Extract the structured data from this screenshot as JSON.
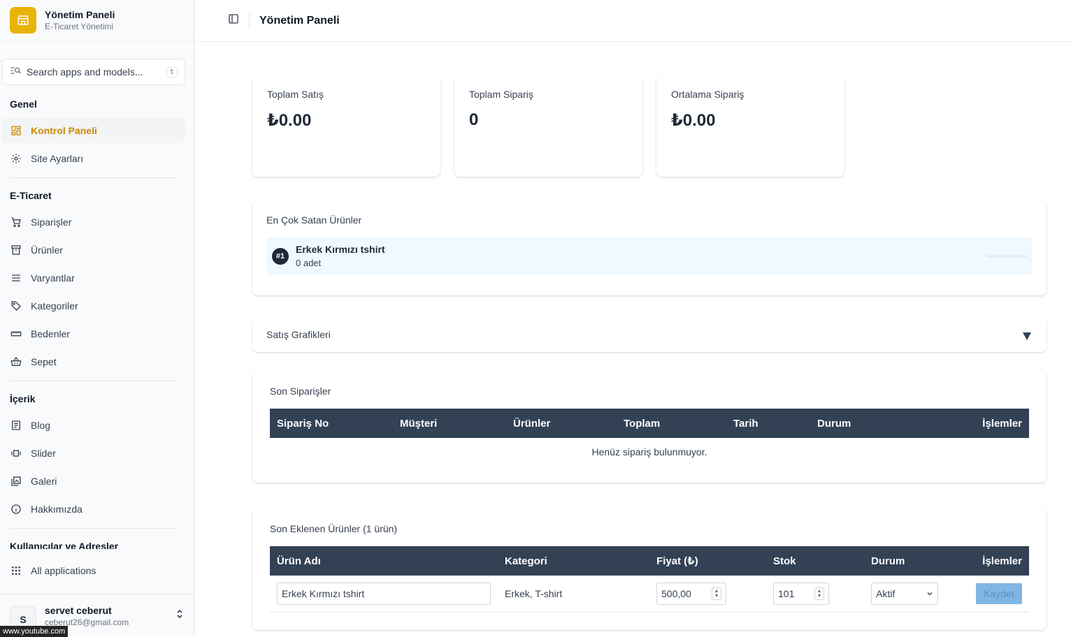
{
  "brand": {
    "title": "Yönetim Paneli",
    "subtitle": "E-Ticaret Yönetimi"
  },
  "search": {
    "placeholder": "Search apps and models...",
    "shortcut": "t"
  },
  "sidebar": {
    "sections": [
      {
        "title": "Genel",
        "items": [
          {
            "label": "Kontrol Paneli",
            "icon": "dashboard-icon",
            "active": true
          },
          {
            "label": "Site Ayarları",
            "icon": "gear-icon"
          }
        ]
      },
      {
        "title": "E-Ticaret",
        "items": [
          {
            "label": "Siparişler",
            "icon": "cart-icon"
          },
          {
            "label": "Ürünler",
            "icon": "archive-icon"
          },
          {
            "label": "Varyantlar",
            "icon": "sliders-icon"
          },
          {
            "label": "Kategoriler",
            "icon": "tag-icon"
          },
          {
            "label": "Bedenler",
            "icon": "ruler-icon"
          },
          {
            "label": "Sepet",
            "icon": "basket-icon"
          }
        ]
      },
      {
        "title": "İçerik",
        "items": [
          {
            "label": "Blog",
            "icon": "document-icon"
          },
          {
            "label": "Slider",
            "icon": "slider-icon"
          },
          {
            "label": "Galeri",
            "icon": "gallery-icon"
          },
          {
            "label": "Hakkımızda",
            "icon": "info-icon"
          }
        ]
      },
      {
        "title": "Kullanıcılar ve Adresler",
        "items": []
      }
    ],
    "all_apps": "All applications"
  },
  "user": {
    "initial": "S",
    "name": "servet ceberut",
    "email": "ceberut26@gmail.com"
  },
  "overlay": {
    "url": "www.youtube.com"
  },
  "header": {
    "title": "Yönetim Paneli"
  },
  "stats": [
    {
      "label": "Toplam Satış",
      "value": "₺0.00"
    },
    {
      "label": "Toplam Sipariş",
      "value": "0"
    },
    {
      "label": "Ortalama Sipariş",
      "value": "₺0.00"
    }
  ],
  "top_products": {
    "title": "En Çok Satan Ürünler",
    "items": [
      {
        "rank": "#1",
        "name": "Erkek Kırmızı tshirt",
        "qty": "0 adet"
      }
    ]
  },
  "sales_charts": {
    "title": "Satış Grafikleri"
  },
  "recent_orders": {
    "title": "Son Siparişler",
    "columns": [
      "Sipariş No",
      "Müşteri",
      "Ürünler",
      "Toplam",
      "Tarih",
      "Durum",
      "İşlemler"
    ],
    "empty": "Henüz sipariş bulunmuyor."
  },
  "recent_products": {
    "title": "Son Eklenen Ürünler (1 ürün)",
    "columns": [
      "Ürün Adı",
      "Kategori",
      "Fiyat (₺)",
      "Stok",
      "Durum",
      "İşlemler"
    ],
    "rows": [
      {
        "name": "Erkek Kırmızı tshirt",
        "category": "Erkek, T-shirt",
        "price": "500,00",
        "stock": "101",
        "status": "Aktif",
        "action": "Kaydet"
      }
    ]
  }
}
